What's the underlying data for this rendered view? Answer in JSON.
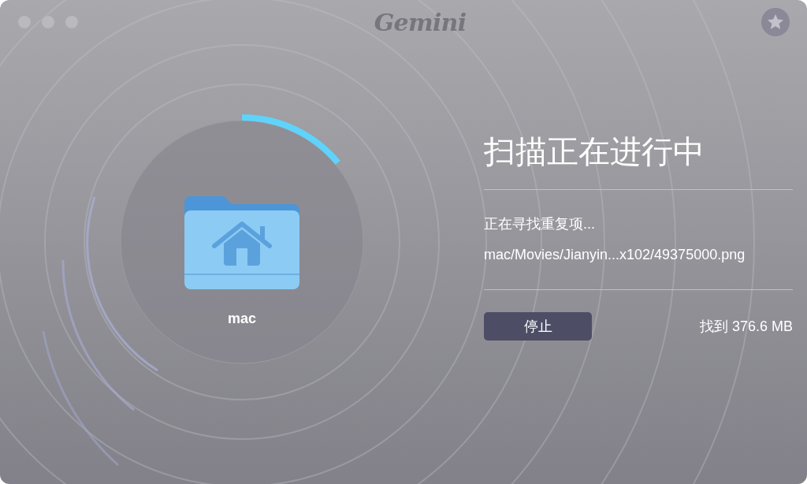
{
  "window": {
    "title": "Gemini"
  },
  "scan": {
    "level": 0.14,
    "folder_name": "mac"
  },
  "status": {
    "title": "扫描正在进行中",
    "activity": "正在寻找重复项...",
    "current_file": "mac/Movies/Jianyin...x102/49375000.png"
  },
  "stop_button": {
    "label": "停止"
  },
  "found": "找到 376.6 MB"
}
